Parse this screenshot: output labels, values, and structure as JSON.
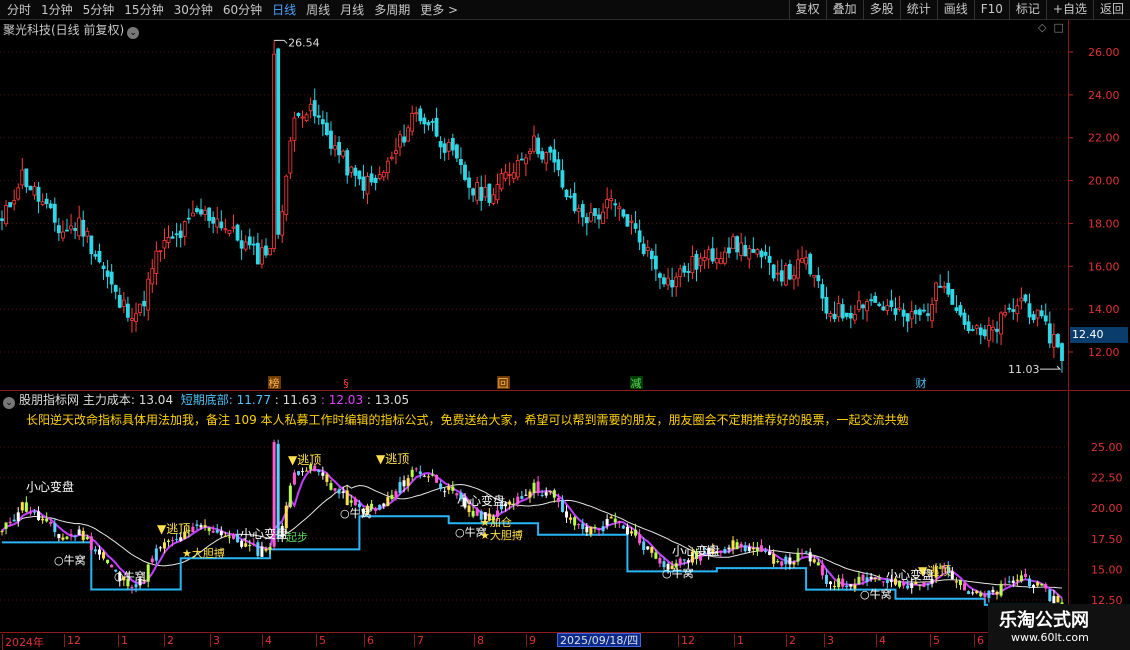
{
  "toolbar": {
    "periods": [
      "分时",
      "1分钟",
      "5分钟",
      "15分钟",
      "30分钟",
      "60分钟",
      "日线",
      "周线",
      "月线",
      "多周期",
      "更多 >"
    ],
    "active_period": "日线",
    "tools": [
      "复权",
      "叠加",
      "多股",
      "统计",
      "画线",
      "F10",
      "标记",
      "+自选",
      "返回"
    ]
  },
  "stock": {
    "title": "聚光科技(日线 前复权)",
    "last_price_tag": "12.40",
    "high_label": "26.54",
    "low_label": "11.03"
  },
  "price_axis": [
    "26.00",
    "24.00",
    "22.00",
    "20.00",
    "18.00",
    "16.00",
    "14.00",
    "12.00"
  ],
  "indicator_axis": [
    "25.00",
    "22.50",
    "20.00",
    "17.50",
    "15.00",
    "12.50"
  ],
  "event_markers": [
    "榜",
    "§",
    "回",
    "减",
    "财"
  ],
  "indicator": {
    "name": "股朋指标网",
    "main_cost_label": "主力成本:",
    "main_cost_value": "13.04",
    "short_bottom_label": "短期底部:",
    "v1": "11.77",
    "v2": "11.63",
    "v3": "12.03",
    "v4": "13.05",
    "note": "长阳逆天改命指标具体用法加我，备注 109 本人私募工作时编辑的指标公式，免费送给大家，希望可以帮到需要的朋友，朋友圈会不定期推荐好的股票，一起交流共勉"
  },
  "chart_labels": {
    "xiaoxinbianpan": "小心变盘",
    "taoding": "逃顶",
    "niuwo": "牛窝",
    "jiacang": "加仓",
    "dadanbo": "大胆搏",
    "qibu": "起步"
  },
  "date_axis": {
    "labels": [
      "2024年",
      "12",
      "1",
      "2",
      "3",
      "4",
      "5",
      "6",
      "7",
      "8",
      "9",
      "12",
      "1",
      "2",
      "3",
      "4",
      "5",
      "6"
    ],
    "selected": "2025/09/18/四"
  },
  "watermark": {
    "title": "乐淘公式网",
    "url": "www.60lt.com"
  },
  "chart_data": {
    "type": "candlestick",
    "ylim": [
      11.03,
      26.54
    ],
    "y_ticks": [
      12,
      14,
      16,
      18,
      20,
      22,
      24,
      26
    ],
    "high": 26.54,
    "low": 11.03,
    "last": 12.4,
    "approx_close_path": [
      18.0,
      20.3,
      19.0,
      17.6,
      18.0,
      16.2,
      14.2,
      13.8,
      16.8,
      17.4,
      18.5,
      18.2,
      17.3,
      16.5,
      17.2,
      23.5,
      23.0,
      21.5,
      20.0,
      19.8,
      21.2,
      23.2,
      22.5,
      21.0,
      19.5,
      19.4,
      20.6,
      21.8,
      21.0,
      18.8,
      18.2,
      18.9,
      18.0,
      16.5,
      15.2,
      16.0,
      16.4,
      17.0,
      16.8,
      16.0,
      15.6,
      16.2,
      14.0,
      13.8,
      14.5,
      14.1,
      13.5,
      13.8,
      15.5,
      13.4,
      12.6,
      13.5,
      14.5,
      13.2,
      12.2
    ]
  }
}
